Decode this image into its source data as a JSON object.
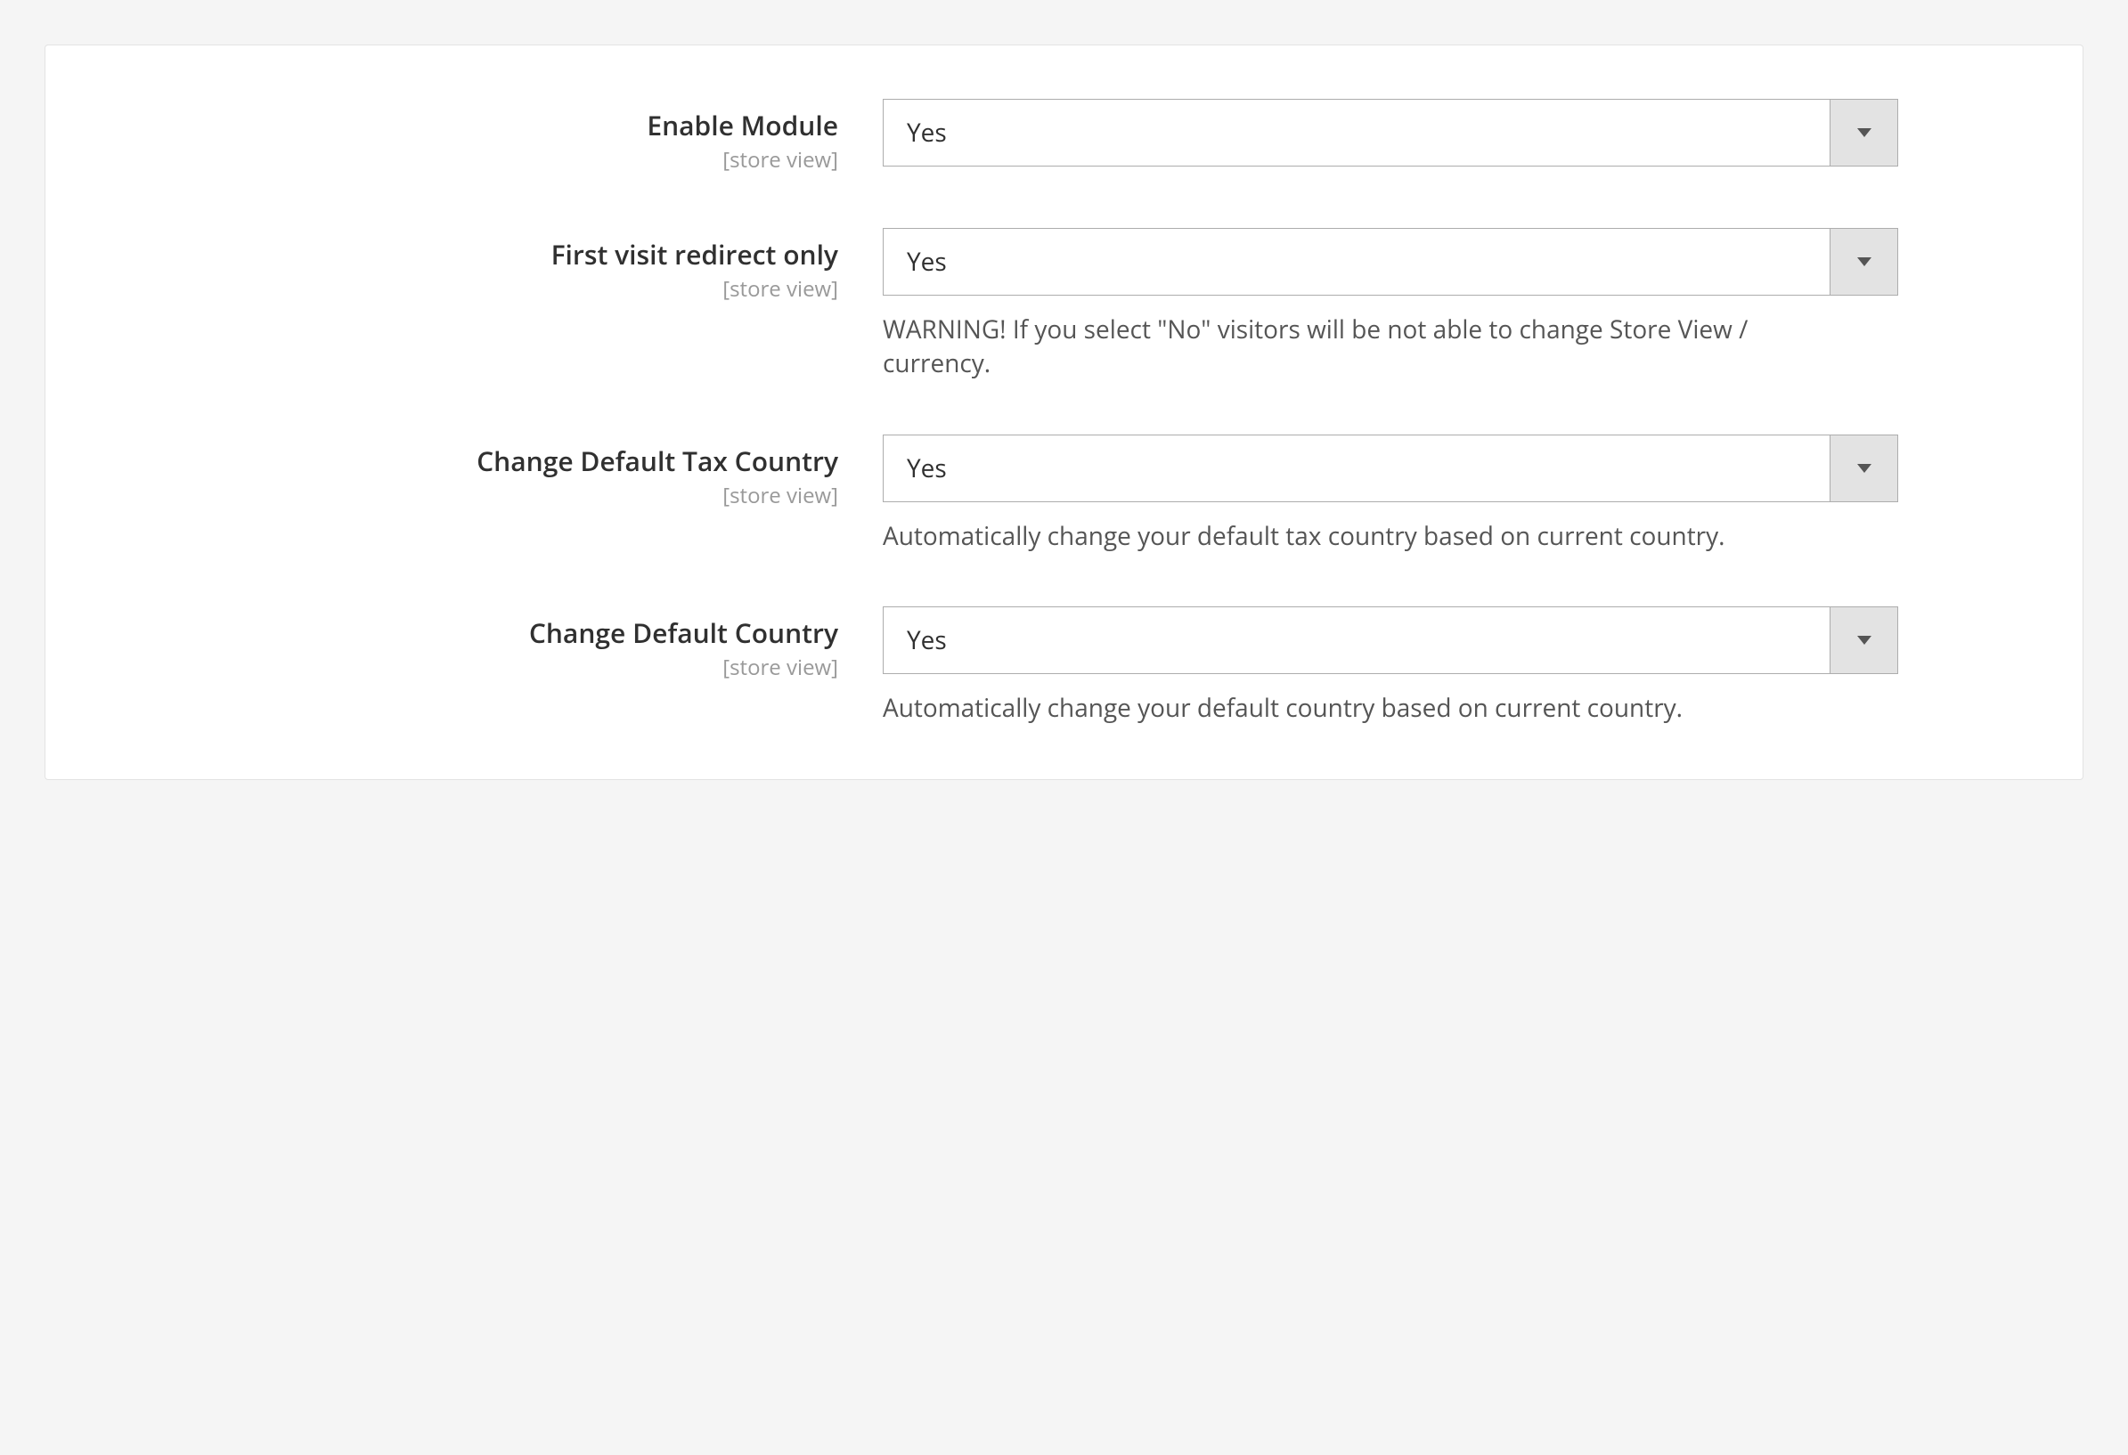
{
  "panel": {
    "fields": [
      {
        "label": "Enable Module",
        "scope": "[store view]",
        "value": "Yes",
        "note": ""
      },
      {
        "label": "First visit redirect only",
        "scope": "[store view]",
        "value": "Yes",
        "note": "WARNING! If you select \"No\" visitors will be not able to change Store View / currency."
      },
      {
        "label": "Change Default Tax Country",
        "scope": "[store view]",
        "value": "Yes",
        "note": "Automatically change your default tax country based on current country."
      },
      {
        "label": "Change Default Country",
        "scope": "[store view]",
        "value": "Yes",
        "note": "Automatically change your default country based on current country."
      }
    ]
  }
}
